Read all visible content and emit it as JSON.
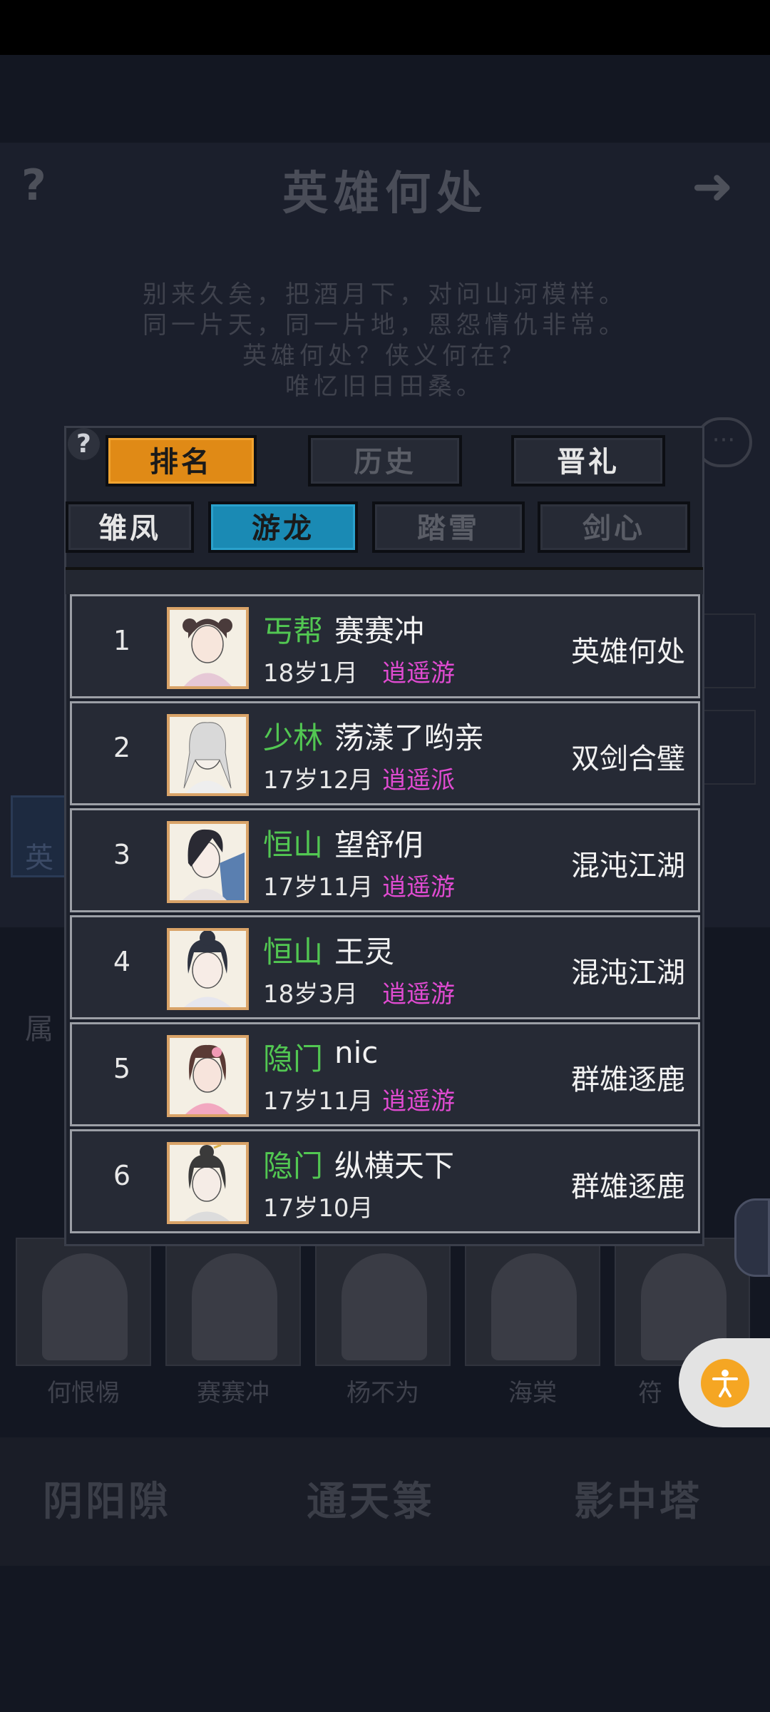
{
  "background": {
    "title": "英雄何处",
    "poem": [
      "别来久矣，把酒月下，对问山河模样。",
      "同一片天，同一片地，恩怨情仇非常。",
      "英雄何处？侠义何在？",
      "唯忆旧日田桑。"
    ],
    "side_tab": "英",
    "attr_label": "属",
    "cards": [
      "何恨惕",
      "赛赛冲",
      "杨不为",
      "海棠",
      "符"
    ],
    "bottom_menu": [
      "阴阳隙",
      "通天箓",
      "影中塔"
    ]
  },
  "modal": {
    "help_label": "?",
    "top_tabs": [
      {
        "label": "排名",
        "state": "active"
      },
      {
        "label": "历史",
        "state": "disabled"
      },
      {
        "label": "晋礼",
        "state": "normal"
      }
    ],
    "sub_tabs": [
      {
        "label": "雏凤",
        "state": "normal"
      },
      {
        "label": "游龙",
        "state": "active"
      },
      {
        "label": "踏雪",
        "state": "disabled"
      },
      {
        "label": "剑心",
        "state": "disabled"
      }
    ],
    "rows": [
      {
        "rank": "1",
        "sect": "丐帮",
        "name": "赛赛冲",
        "age": "18岁1月",
        "school": "逍遥游",
        "server": "英雄何处"
      },
      {
        "rank": "2",
        "sect": "少林",
        "name": "荡漾了哟亲",
        "age": "17岁12月",
        "school": "逍遥派",
        "server": "双剑合璧"
      },
      {
        "rank": "3",
        "sect": "恒山",
        "name": "望舒仴",
        "age": "17岁11月",
        "school": "逍遥游",
        "server": "混沌江湖"
      },
      {
        "rank": "4",
        "sect": "恒山",
        "name": "王灵",
        "age": "18岁3月",
        "school": "逍遥游",
        "server": "混沌江湖"
      },
      {
        "rank": "5",
        "sect": "隐门",
        "name": "nic",
        "age": "17岁11月",
        "school": "逍遥游",
        "server": "群雄逐鹿"
      },
      {
        "rank": "6",
        "sect": "隐门",
        "name": "纵横天下",
        "age": "17岁10月",
        "school": "",
        "server": "群雄逐鹿"
      }
    ]
  },
  "colors": {
    "sect_green": "#52c752",
    "school_magenta": "#e04bd1",
    "tab_orange": "#e08a16",
    "tab_blue": "#1a8ab4",
    "a11y_orange": "#f5a623"
  },
  "icons": {
    "help": "question-mark",
    "next": "arrow-right",
    "chat": "speech-bubble",
    "accessibility": "person-figure"
  }
}
